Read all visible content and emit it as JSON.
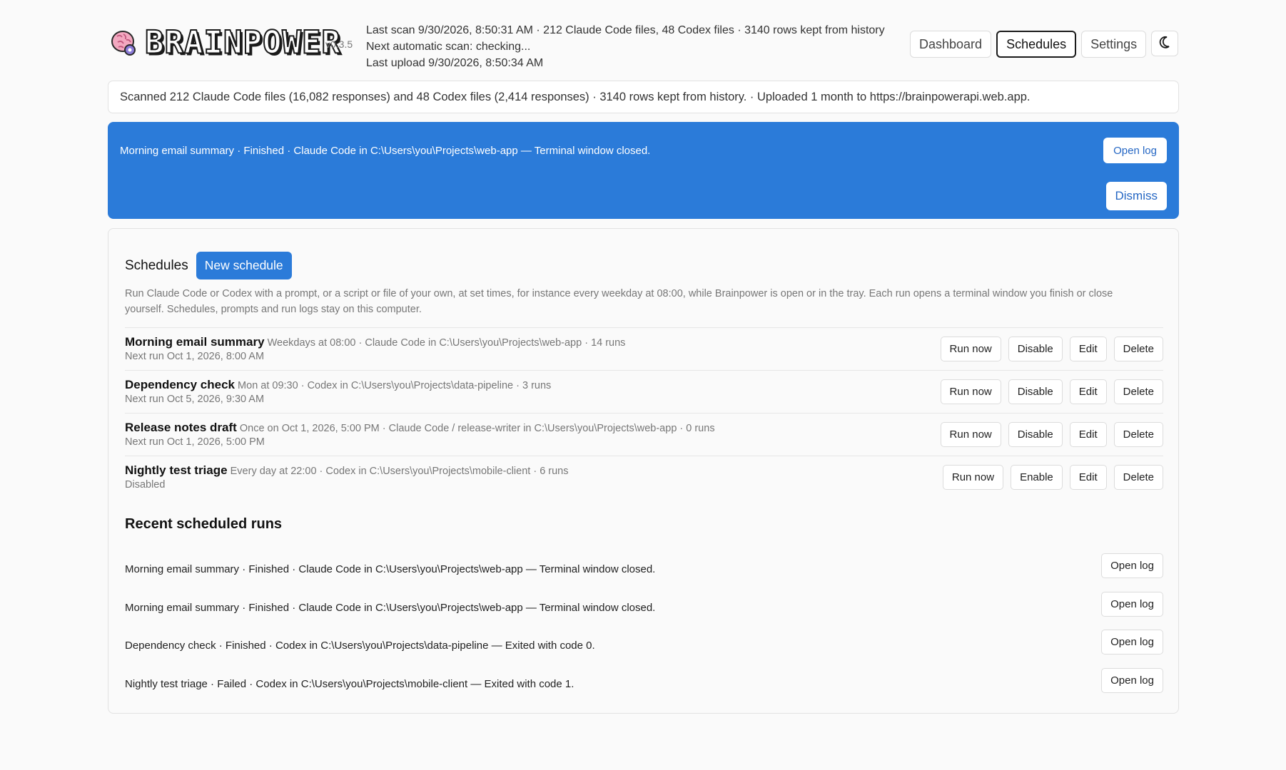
{
  "app": {
    "name": "BRAINPOWER",
    "version": "v0.3.5"
  },
  "status": {
    "last_scan": "Last scan 9/30/2026, 8:50:31 AM · 212 Claude Code files, 48 Codex files · 3140 rows kept from history",
    "next_scan": "Next automatic scan: checking...",
    "last_upload": "Last upload 9/30/2026, 8:50:34 AM"
  },
  "nav": {
    "dashboard": "Dashboard",
    "schedules": "Schedules",
    "settings": "Settings",
    "active": "Schedules",
    "theme_icon": "moon-icon"
  },
  "scan_summary": "Scanned 212 Claude Code files (16,082 responses) and 48 Codex files (2,414 responses) · 3140 rows kept from history. · Uploaded 1 month to https://brainpowerapi.web.app.",
  "banner": {
    "text": "Morning email summary · Finished · Claude Code in C:\\Users\\you\\Projects\\web-app — Terminal window closed.",
    "open_log": "Open log",
    "dismiss": "Dismiss",
    "color": "#2b7bd9"
  },
  "schedules": {
    "title": "Schedules",
    "new_button": "New schedule",
    "description": "Run Claude Code or Codex with a prompt, or a script or file of your own, at set times, for instance every weekday at 08:00, while Brainpower is open or in the tray. Each run opens a terminal window you finish or close yourself. Schedules, prompts and run logs stay on this computer.",
    "items": [
      {
        "name": "Morning email summary",
        "detail": "Weekdays at 08:00 · Claude Code in C:\\Users\\you\\Projects\\web-app · 14 runs",
        "sub": "Next run Oct 1, 2026, 8:00 AM",
        "run_now": "Run now",
        "toggle": "Disable",
        "edit": "Edit",
        "delete": "Delete"
      },
      {
        "name": "Dependency check",
        "detail": "Mon at 09:30 · Codex in C:\\Users\\you\\Projects\\data-pipeline · 3 runs",
        "sub": "Next run Oct 5, 2026, 9:30 AM",
        "run_now": "Run now",
        "toggle": "Disable",
        "edit": "Edit",
        "delete": "Delete"
      },
      {
        "name": "Release notes draft",
        "detail": "Once on Oct 1, 2026, 5:00 PM · Claude Code / release-writer in C:\\Users\\you\\Projects\\web-app · 0 runs",
        "sub": "Next run Oct 1, 2026, 5:00 PM",
        "run_now": "Run now",
        "toggle": "Disable",
        "edit": "Edit",
        "delete": "Delete"
      },
      {
        "name": "Nightly test triage",
        "detail": "Every day at 22:00 · Codex in C:\\Users\\you\\Projects\\mobile-client · 6 runs",
        "sub": "Disabled",
        "run_now": "Run now",
        "toggle": "Enable",
        "edit": "Edit",
        "delete": "Delete"
      }
    ]
  },
  "recent": {
    "title": "Recent scheduled runs",
    "runs": [
      {
        "text": "Morning email summary · Finished · Claude Code in C:\\Users\\you\\Projects\\web-app — Terminal window closed.",
        "open_log": "Open log"
      },
      {
        "text": "Morning email summary · Finished · Claude Code in C:\\Users\\you\\Projects\\web-app — Terminal window closed.",
        "open_log": "Open log"
      },
      {
        "text": "Dependency check · Finished · Codex in C:\\Users\\you\\Projects\\data-pipeline — Exited with code 0.",
        "open_log": "Open log"
      },
      {
        "text": "Nightly test triage · Failed · Codex in C:\\Users\\you\\Projects\\mobile-client — Exited with code 1.",
        "open_log": "Open log"
      }
    ]
  }
}
